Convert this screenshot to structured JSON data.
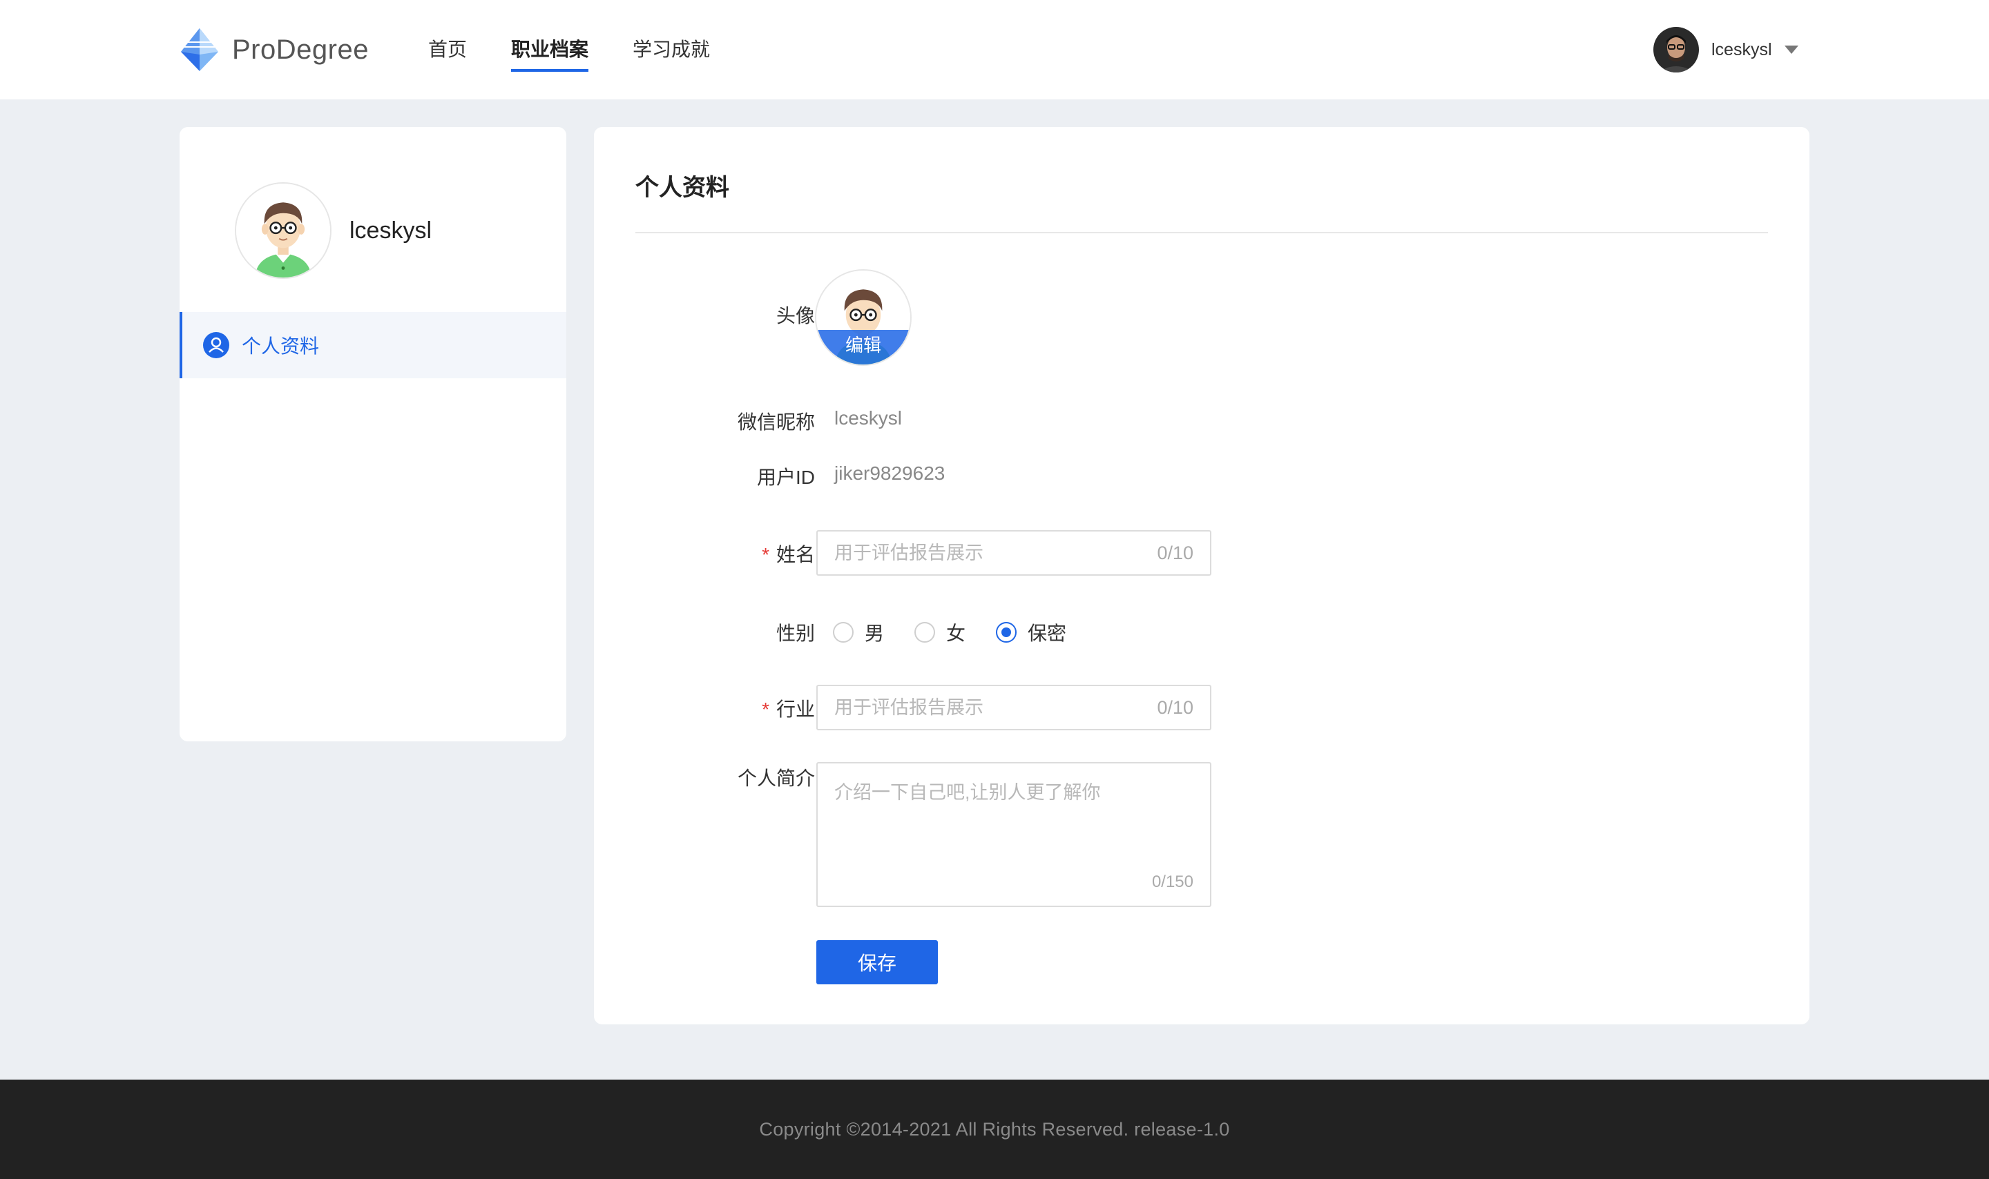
{
  "header": {
    "brand": "ProDegree",
    "nav": [
      {
        "label": "首页",
        "active": false
      },
      {
        "label": "职业档案",
        "active": true
      },
      {
        "label": "学习成就",
        "active": false
      }
    ],
    "user_name": "lceskysl"
  },
  "sidebar": {
    "user_name": "lceskysl",
    "menu": [
      {
        "label": "个人资料",
        "icon": "user-icon",
        "active": true
      }
    ]
  },
  "profile_form": {
    "title": "个人资料",
    "avatar": {
      "label": "头像",
      "edit_label": "编辑"
    },
    "wechat_nickname": {
      "label": "微信昵称",
      "value": "lceskysl"
    },
    "user_id": {
      "label": "用户ID",
      "value": "jiker9829623"
    },
    "name": {
      "label": "姓名",
      "required_mark": "*",
      "placeholder": "用于评估报告展示",
      "counter": "0/10"
    },
    "gender": {
      "label": "性别",
      "options": [
        {
          "label": "男",
          "checked": false
        },
        {
          "label": "女",
          "checked": false
        },
        {
          "label": "保密",
          "checked": true
        }
      ]
    },
    "industry": {
      "label": "行业",
      "required_mark": "*",
      "placeholder": "用于评估报告展示",
      "counter": "0/10"
    },
    "bio": {
      "label": "个人简介",
      "placeholder": "介绍一下自己吧,让别人更了解你",
      "counter": "0/150"
    },
    "save_label": "保存"
  },
  "footer": {
    "copyright": "Copyright ©2014-2021 All Rights Reserved. release-1.0"
  },
  "colors": {
    "accent": "#1F66E6",
    "page_bg": "#ECEFF3",
    "footer_bg": "#222222",
    "required": "#E53935"
  }
}
